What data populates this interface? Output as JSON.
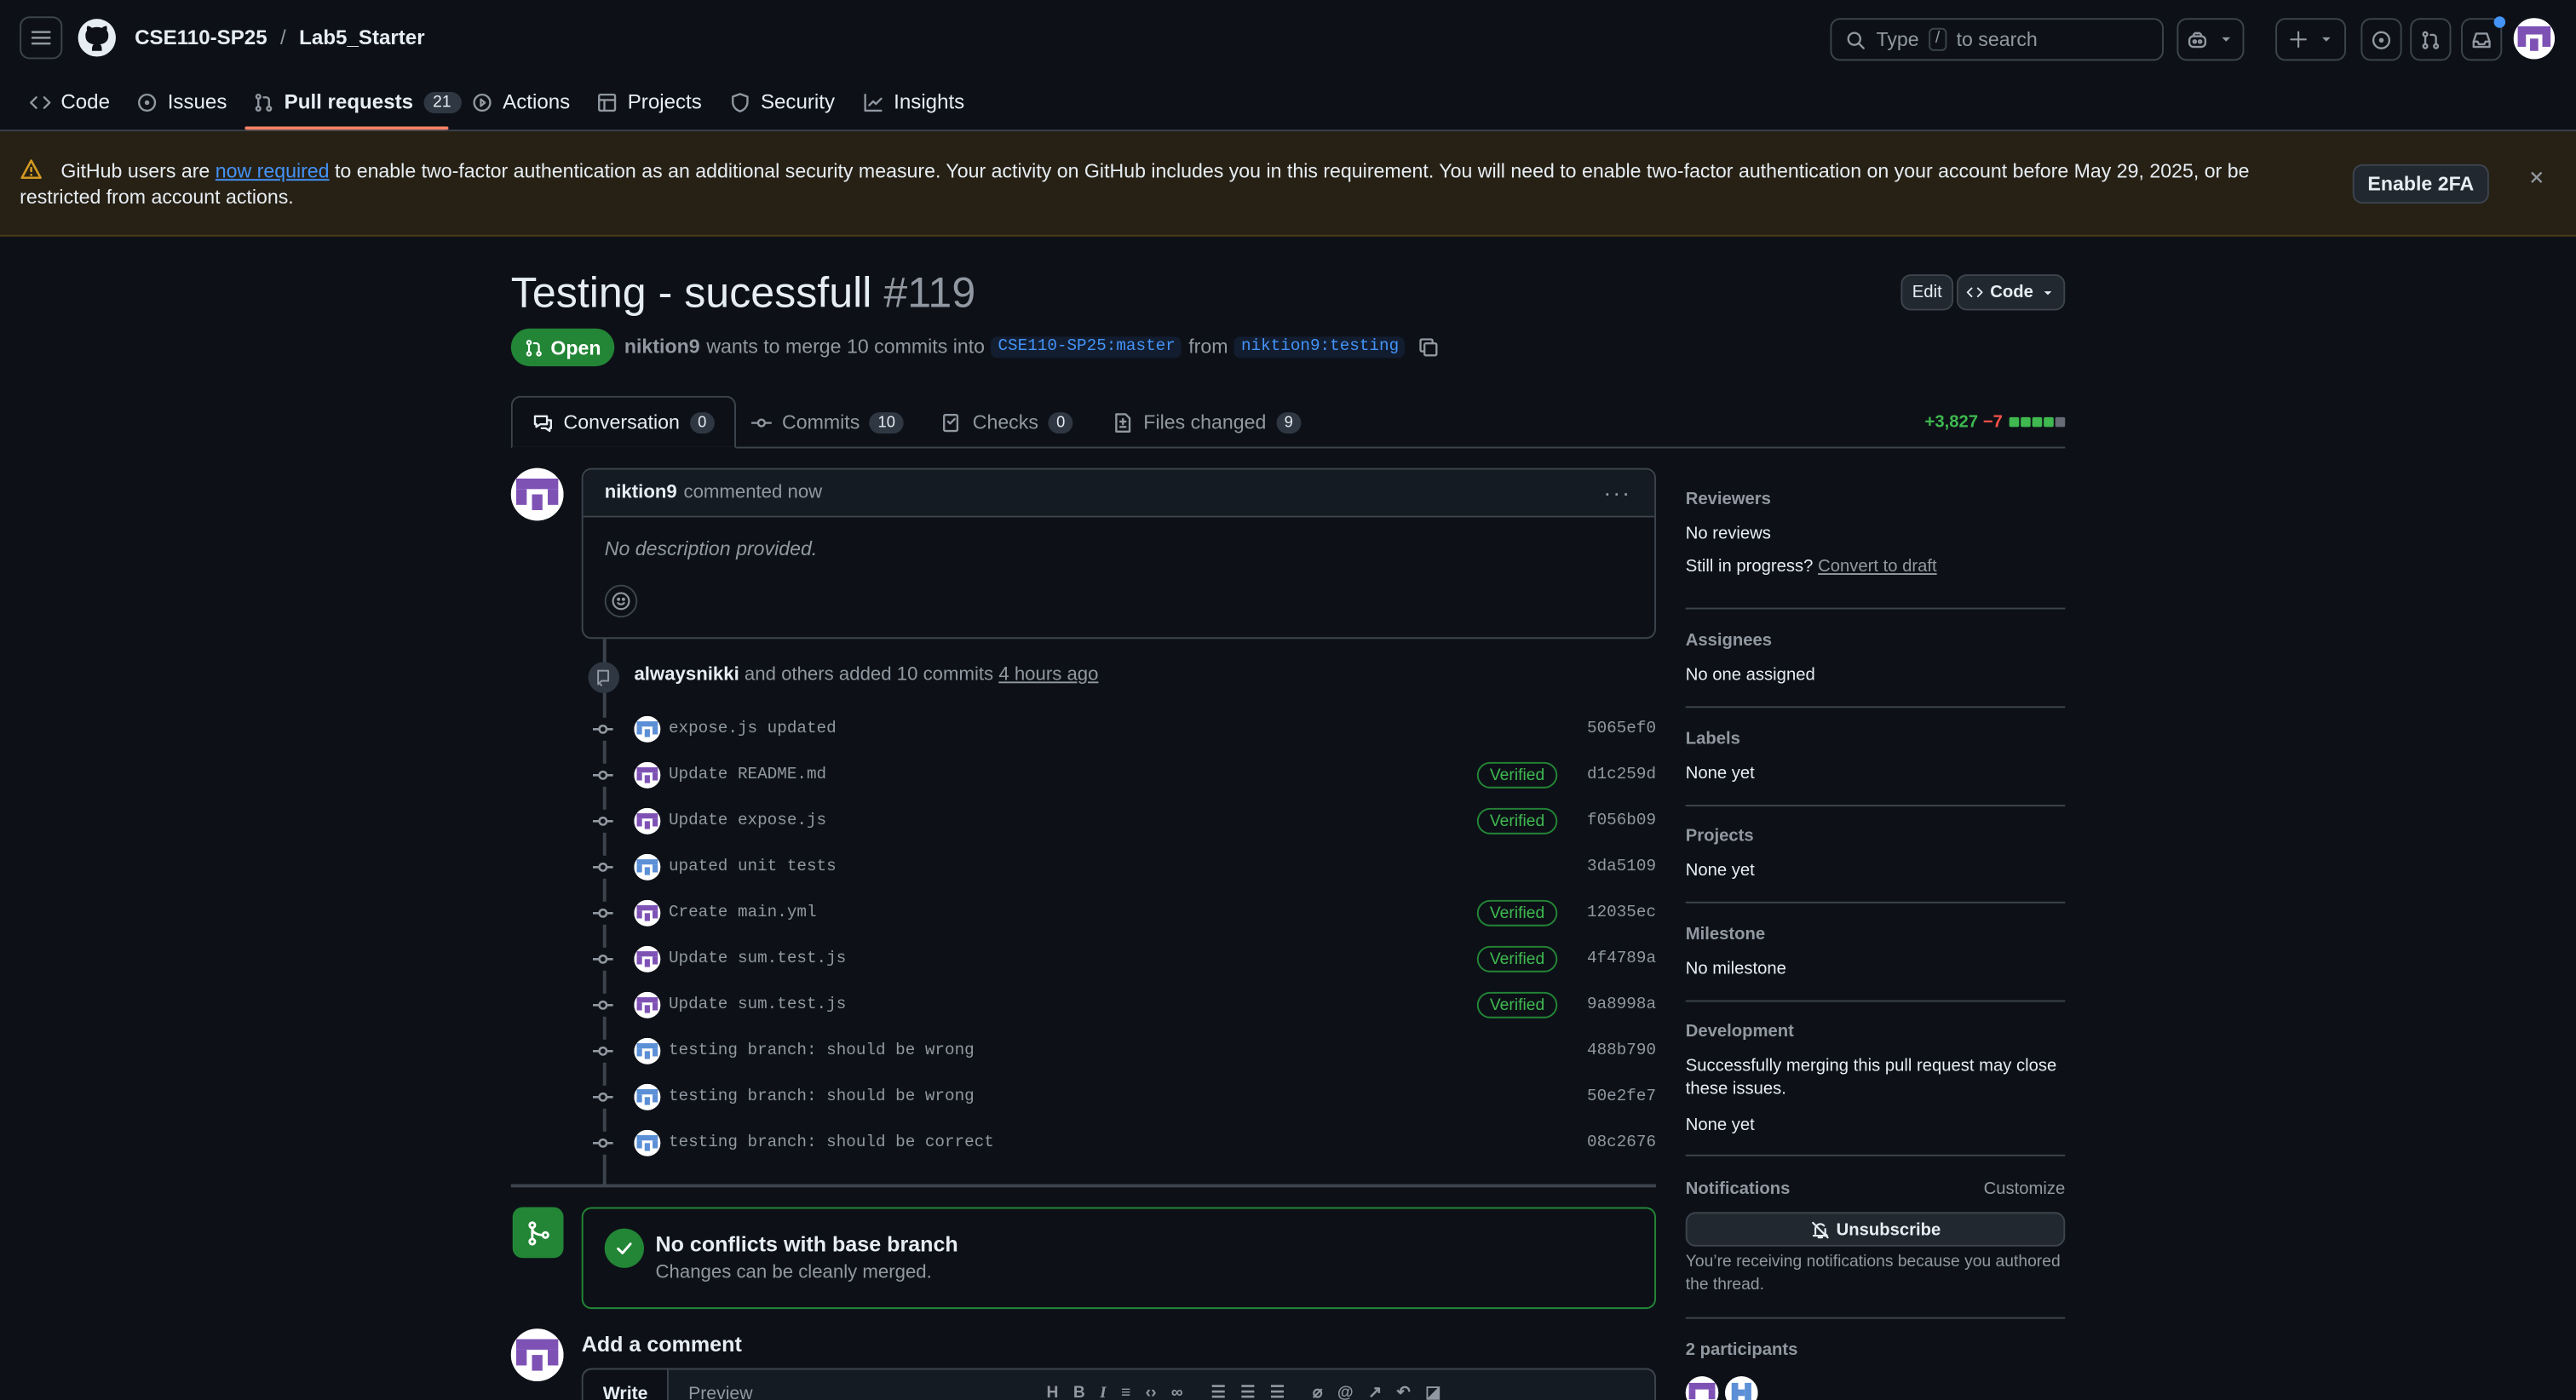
{
  "header": {
    "owner": "CSE110-SP25",
    "separator": "/",
    "repo": "Lab5_Starter",
    "search_prefix": "Type",
    "search_key": "/",
    "search_suffix": "to search"
  },
  "nav": {
    "items": [
      {
        "label": "Code",
        "icon": "code-icon"
      },
      {
        "label": "Issues",
        "icon": "issue-icon"
      },
      {
        "label": "Pull requests",
        "icon": "pull-request-icon",
        "count": "21"
      },
      {
        "label": "Actions",
        "icon": "play-icon"
      },
      {
        "label": "Projects",
        "icon": "table-icon"
      },
      {
        "label": "Security",
        "icon": "shield-icon"
      },
      {
        "label": "Insights",
        "icon": "graph-icon"
      }
    ]
  },
  "banner": {
    "text_before": "GitHub users are ",
    "link": "now required",
    "text_after": " to enable two-factor authentication as an additional security measure. Your activity on GitHub includes you in this requirement. You will need to enable two-factor authentication on your account before May 29, 2025, or be restricted from account actions.",
    "button": "Enable 2FA"
  },
  "pr": {
    "title": "Testing - sucessfull",
    "number": "#119",
    "edit_label": "Edit",
    "code_label": "Code",
    "state": "Open",
    "author": "niktion9",
    "merge_text": "wants to merge 10 commits into",
    "base": "CSE110-SP25:master",
    "from_text": "from",
    "head": "niktion9:testing"
  },
  "tabs": [
    {
      "label": "Conversation",
      "count": "0"
    },
    {
      "label": "Commits",
      "count": "10"
    },
    {
      "label": "Checks",
      "count": "0"
    },
    {
      "label": "Files changed",
      "count": "9"
    }
  ],
  "diffstat": {
    "additions": "+3,827",
    "deletions": "−7"
  },
  "comment": {
    "author": "niktion9",
    "action": "commented now",
    "body": "No description provided."
  },
  "push": {
    "author": "alwaysnikki",
    "text": "and others added 10 commits",
    "time": "4 hours ago"
  },
  "commits": [
    {
      "msg": "expose.js updated",
      "sha": "5065ef0",
      "verified": "",
      "avatar": "blue"
    },
    {
      "msg": "Update README.md",
      "sha": "d1c259d",
      "verified": "Verified",
      "avatar": "purple"
    },
    {
      "msg": "Update expose.js",
      "sha": "f056b09",
      "verified": "Verified",
      "avatar": "purple"
    },
    {
      "msg": "upated unit tests",
      "sha": "3da5109",
      "verified": "",
      "avatar": "blue"
    },
    {
      "msg": "Create main.yml",
      "sha": "12035ec",
      "verified": "Verified",
      "avatar": "purple"
    },
    {
      "msg": "Update sum.test.js",
      "sha": "4f4789a",
      "verified": "Verified",
      "avatar": "purple"
    },
    {
      "msg": "Update sum.test.js",
      "sha": "9a8998a",
      "verified": "Verified",
      "avatar": "purple"
    },
    {
      "msg": "testing branch: should be wrong",
      "sha": "488b790",
      "verified": "",
      "avatar": "blue"
    },
    {
      "msg": "testing branch: should be wrong",
      "sha": "50e2fe7",
      "verified": "",
      "avatar": "blue"
    },
    {
      "msg": "testing branch: should be correct",
      "sha": "08c2676",
      "verified": "",
      "avatar": "blue"
    }
  ],
  "merge": {
    "title": "No conflicts with base branch",
    "subtitle": "Changes can be cleanly merged."
  },
  "add_comment": {
    "title": "Add a comment",
    "write": "Write",
    "preview": "Preview"
  },
  "sidebar": {
    "reviewers_h": "Reviewers",
    "reviewers_v": "No reviews",
    "progress_text": "Still in progress?",
    "progress_link": "Convert to draft",
    "assignees_h": "Assignees",
    "assignees_v": "No one assigned",
    "labels_h": "Labels",
    "labels_v": "None yet",
    "projects_h": "Projects",
    "projects_v": "None yet",
    "milestone_h": "Milestone",
    "milestone_v": "No milestone",
    "development_h": "Development",
    "development_text": "Successfully merging this pull request may close these issues.",
    "development_v": "None yet",
    "notifications_h": "Notifications",
    "customize": "Customize",
    "unsubscribe": "Unsubscribe",
    "notif_reason": "You’re receiving notifications because you authored the thread.",
    "participants_h": "2 participants"
  },
  "colors": {
    "accent": "#4493f8",
    "success": "#238636",
    "underline": "#f78166",
    "bg": "#0d1117"
  }
}
